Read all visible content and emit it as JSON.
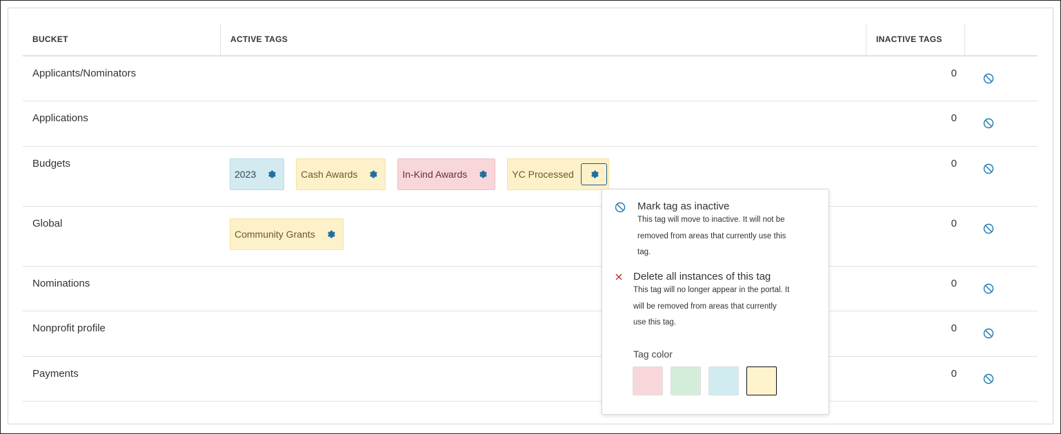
{
  "table": {
    "headers": {
      "bucket": "BUCKET",
      "active": "ACTIVE TAGS",
      "inactive": "INACTIVE TAGS"
    },
    "rows": [
      {
        "bucket": "Applicants/Nominators",
        "inactive_count": "0",
        "tags": []
      },
      {
        "bucket": "Applications",
        "inactive_count": "0",
        "tags": []
      },
      {
        "bucket": "Budgets",
        "inactive_count": "0",
        "tags": [
          {
            "label": "2023",
            "color": "blue"
          },
          {
            "label": "Cash Awards",
            "color": "yellow"
          },
          {
            "label": "In-Kind Awards",
            "color": "pink"
          },
          {
            "label": "YC Processed",
            "color": "yellow"
          }
        ]
      },
      {
        "bucket": "Global",
        "inactive_count": "0",
        "tags": [
          {
            "label": "Community Grants",
            "color": "yellow"
          }
        ]
      },
      {
        "bucket": "Nominations",
        "inactive_count": "0",
        "tags": []
      },
      {
        "bucket": "Nonprofit profile",
        "inactive_count": "0",
        "tags": []
      },
      {
        "bucket": "Payments",
        "inactive_count": "0",
        "tags": []
      }
    ],
    "row_action_icon": "ban-icon"
  },
  "popover": {
    "mark_inactive": {
      "title": "Mark tag as inactive",
      "desc_lines": [
        "This tag will move to inactive. It will not be",
        "removed from areas that currently use this",
        "tag."
      ]
    },
    "delete": {
      "title": "Delete all instances of this tag",
      "desc_lines": [
        "This tag will no longer appear in the portal. It",
        "will be removed from areas that currently",
        "use this tag."
      ]
    },
    "tag_color_label": "Tag color",
    "swatches": [
      {
        "name": "pink",
        "color": "#f8d7da",
        "selected": false
      },
      {
        "name": "green",
        "color": "#d4edda",
        "selected": false
      },
      {
        "name": "blue",
        "color": "#d1ecf1",
        "selected": false
      },
      {
        "name": "yellow",
        "color": "#fff3cd",
        "selected": true
      }
    ]
  },
  "colors": {
    "accent": "#1d6fa5",
    "icon_blue": "#1f78b4",
    "delete_red": "#c0392b"
  }
}
